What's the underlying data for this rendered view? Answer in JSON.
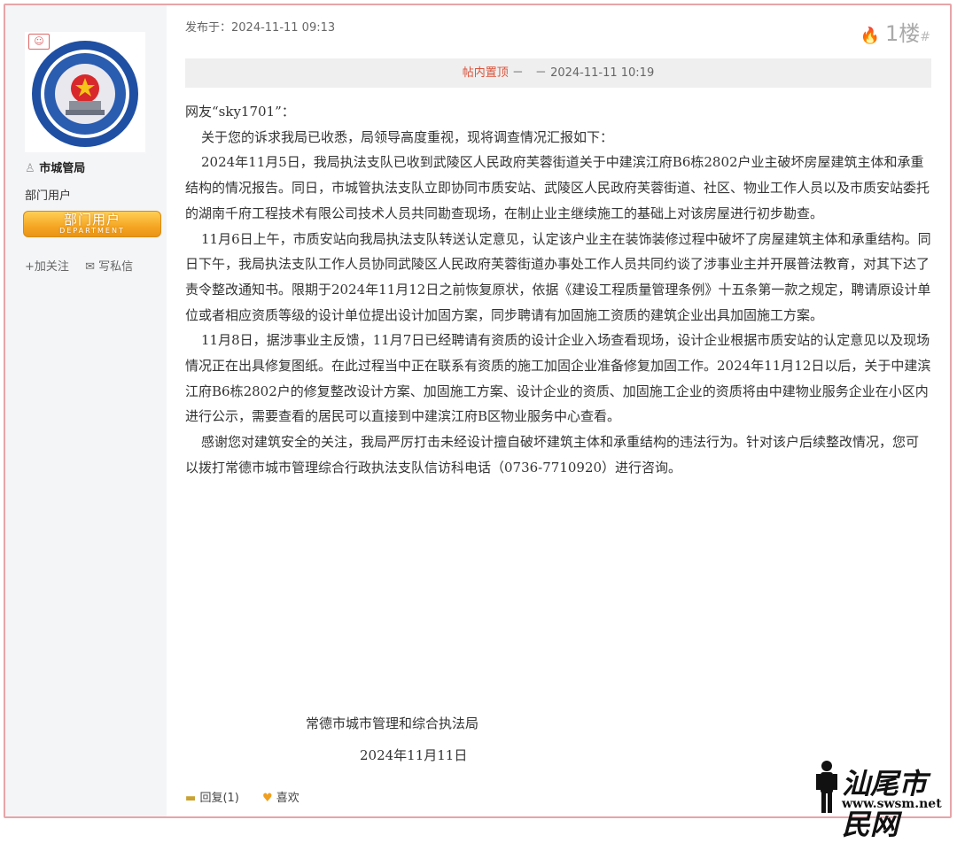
{
  "user": {
    "avatar_badge": "☺",
    "username": "市城管局",
    "group": "部门用户",
    "badge_zh": "部门用户",
    "badge_en": "DEPARTMENT",
    "follow": "加关注",
    "message": "写私信"
  },
  "post": {
    "published": "发布于：2024-11-11 09:13",
    "floor": "1楼",
    "floor_hash": "#",
    "pinned_label": "帖内置顶",
    "pinned_sep": "－　－",
    "pinned_time": "2024-11-11 10:19",
    "greeting": "网友“sky1701”：",
    "paragraphs": [
      "关于您的诉求我局已收悉，局领导高度重视，现将调查情况汇报如下：",
      "2024年11月5日，我局执法支队已收到武陵区人民政府芙蓉街道关于中建滨江府B6栋2802户业主破坏房屋建筑主体和承重结构的情况报告。同日，市城管执法支队立即协同市质安站、武陵区人民政府芙蓉街道、社区、物业工作人员以及市质安站委托的湖南千府工程技术有限公司技术人员共同勘查现场，在制止业主继续施工的基础上对该房屋进行初步勘查。",
      "11月6日上午，市质安站向我局执法支队转送认定意见，认定该户业主在装饰装修过程中破坏了房屋建筑主体和承重结构。同日下午，我局执法支队工作人员协同武陵区人民政府芙蓉街道办事处工作人员共同约谈了涉事业主并开展普法教育，对其下达了责令整改通知书。限期于2024年11月12日之前恢复原状，依据《建设工程质量管理条例》十五条第一款之规定，聘请原设计单位或者相应资质等级的设计单位提出设计加固方案，同步聘请有加固施工资质的建筑企业出具加固施工方案。",
      "11月8日，据涉事业主反馈，11月7日已经聘请有资质的设计企业入场查看现场，设计企业根据市质安站的认定意见以及现场情况正在出具修复图纸。在此过程当中正在联系有资质的施工加固企业准备修复加固工作。2024年11月12日以后，关于中建滨江府B6栋2802户的修复整改设计方案、加固施工方案、设计企业的资质、加固施工企业的资质将由中建物业服务企业在小区内进行公示，需要查看的居民可以直接到中建滨江府B区物业服务中心查看。",
      "感谢您对建筑安全的关注，我局严厉打击未经设计擅自破坏建筑主体和承重结构的违法行为。针对该户后续整改情况，您可以拨打常德市城市管理综合行政执法支队信访科电话（0736-7710920）进行咨询。"
    ],
    "signature": "常德市城市管理和综合执法局",
    "date": "2024年11月11日"
  },
  "footer": {
    "reply": "回复(1)",
    "like": "喜欢"
  },
  "watermark": {
    "text": "汕尾市民网",
    "url": "www.swsm.net"
  },
  "colors": {
    "frame": "#e7a4a8",
    "pin": "#d9523a",
    "badge": "#f5a623"
  }
}
